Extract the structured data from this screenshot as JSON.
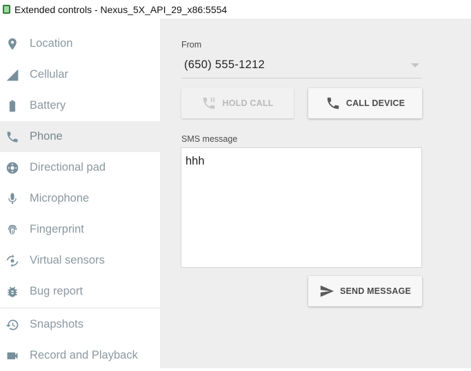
{
  "window": {
    "title": "Extended controls - Nexus_5X_API_29_x86:5554"
  },
  "sidebar": {
    "items": [
      {
        "label": "Location",
        "icon": "location-pin-icon"
      },
      {
        "label": "Cellular",
        "icon": "cellular-signal-icon"
      },
      {
        "label": "Battery",
        "icon": "battery-icon"
      },
      {
        "label": "Phone",
        "icon": "phone-icon",
        "selected": true
      },
      {
        "label": "Directional pad",
        "icon": "dpad-icon"
      },
      {
        "label": "Microphone",
        "icon": "microphone-icon"
      },
      {
        "label": "Fingerprint",
        "icon": "fingerprint-icon"
      },
      {
        "label": "Virtual sensors",
        "icon": "rotation-icon"
      },
      {
        "label": "Bug report",
        "icon": "bug-icon"
      },
      {
        "label": "Snapshots",
        "icon": "history-icon"
      },
      {
        "label": "Record and Playback",
        "icon": "videocam-icon"
      }
    ]
  },
  "phone": {
    "from_label": "From",
    "from_value": "(650) 555-1212",
    "hold_call_label": "HOLD CALL",
    "call_device_label": "CALL DEVICE",
    "sms_label": "SMS message",
    "sms_value": "hhh",
    "send_message_label": "SEND MESSAGE"
  },
  "colors": {
    "sidebar_icon": "#78909c",
    "panel_bg": "#eeeeee",
    "selected_bg": "#eeeeee"
  }
}
